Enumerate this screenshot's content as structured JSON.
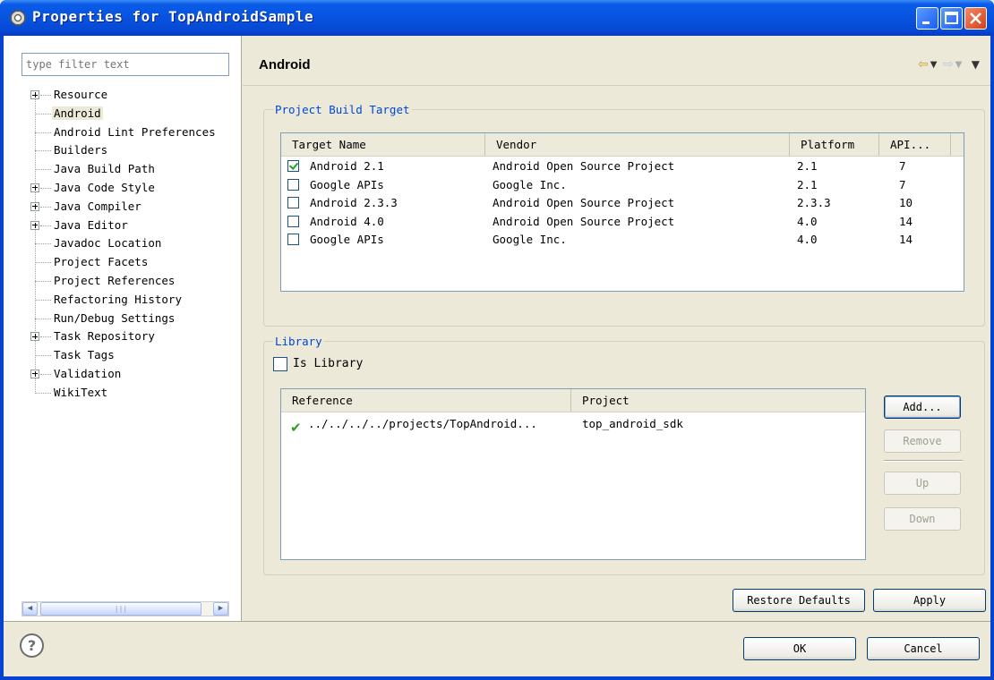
{
  "window": {
    "title": "Properties for TopAndroidSample",
    "icon": "gear-icon"
  },
  "sidebar": {
    "filter_placeholder": "type filter text",
    "items": [
      {
        "label": "Resource",
        "expandable": true
      },
      {
        "label": "Android",
        "expandable": false,
        "selected": true
      },
      {
        "label": "Android Lint Preferences",
        "expandable": false
      },
      {
        "label": "Builders",
        "expandable": false
      },
      {
        "label": "Java Build Path",
        "expandable": false
      },
      {
        "label": "Java Code Style",
        "expandable": true
      },
      {
        "label": "Java Compiler",
        "expandable": true
      },
      {
        "label": "Java Editor",
        "expandable": true
      },
      {
        "label": "Javadoc Location",
        "expandable": false
      },
      {
        "label": "Project Facets",
        "expandable": false
      },
      {
        "label": "Project References",
        "expandable": false
      },
      {
        "label": "Refactoring History",
        "expandable": false
      },
      {
        "label": "Run/Debug Settings",
        "expandable": false
      },
      {
        "label": "Task Repository",
        "expandable": true
      },
      {
        "label": "Task Tags",
        "expandable": false
      },
      {
        "label": "Validation",
        "expandable": true
      },
      {
        "label": "WikiText",
        "expandable": false
      }
    ]
  },
  "page": {
    "title": "Android"
  },
  "build_target": {
    "group_title": "Project Build Target",
    "columns": [
      "Target Name",
      "Vendor",
      "Platform",
      "API..."
    ],
    "rows": [
      {
        "checked": true,
        "name": "Android 2.1",
        "vendor": "Android Open Source Project",
        "platform": "2.1",
        "api": "7"
      },
      {
        "checked": false,
        "name": "Google APIs",
        "vendor": "Google Inc.",
        "platform": "2.1",
        "api": "7"
      },
      {
        "checked": false,
        "name": "Android 2.3.3",
        "vendor": "Android Open Source Project",
        "platform": "2.3.3",
        "api": "10"
      },
      {
        "checked": false,
        "name": "Android 4.0",
        "vendor": "Android Open Source Project",
        "platform": "4.0",
        "api": "14"
      },
      {
        "checked": false,
        "name": "Google APIs",
        "vendor": "Google Inc.",
        "platform": "4.0",
        "api": "14"
      }
    ]
  },
  "library": {
    "group_title": "Library",
    "is_library_label": "Is Library",
    "is_library_checked": false,
    "columns": [
      "Reference",
      "Project"
    ],
    "rows": [
      {
        "reference": "../../../../projects/TopAndroid...",
        "project": "top_android_sdk"
      }
    ],
    "buttons": {
      "add": "Add...",
      "remove": "Remove",
      "up": "Up",
      "down": "Down"
    }
  },
  "actions": {
    "restore_defaults": "Restore Defaults",
    "apply": "Apply",
    "ok": "OK",
    "cancel": "Cancel"
  }
}
